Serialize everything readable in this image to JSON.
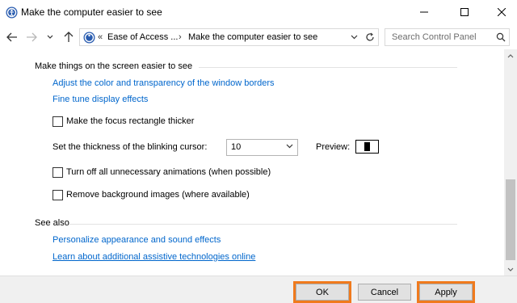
{
  "window": {
    "title": "Make the computer easier to see",
    "app_icon": "ease-of-access-icon",
    "controls": [
      "minimize-icon",
      "maximize-icon",
      "close-icon"
    ]
  },
  "address_bar": {
    "overflow_chevron": "«",
    "crumbs": [
      "Ease of Access ...",
      "Make the computer easier to see"
    ],
    "separator": "›",
    "search_placeholder": "Search Control Panel"
  },
  "content": {
    "screen_section": {
      "heading": "Make things on the screen easier to see",
      "links": [
        "Adjust the color and transparency of the window borders",
        "Fine tune display effects"
      ],
      "focus_checkbox": {
        "label": "Make the focus rectangle thicker",
        "checked": false
      },
      "cursor": {
        "label": "Set the thickness of the blinking cursor:",
        "value": "10",
        "preview_label": "Preview:"
      },
      "animations_checkbox": {
        "label": "Turn off all unnecessary animations (when possible)",
        "checked": false
      },
      "background_checkbox": {
        "label": "Remove background images (where available)",
        "checked": false
      }
    },
    "see_also": {
      "heading": "See also",
      "links": [
        "Personalize appearance and sound effects",
        "Learn about additional assistive technologies online"
      ]
    }
  },
  "footer": {
    "ok": "OK",
    "cancel": "Cancel",
    "apply": "Apply",
    "highlight_color": "#f07a1d"
  },
  "colors": {
    "link": "#0066cc",
    "footer_bg": "#f0f0f0"
  }
}
